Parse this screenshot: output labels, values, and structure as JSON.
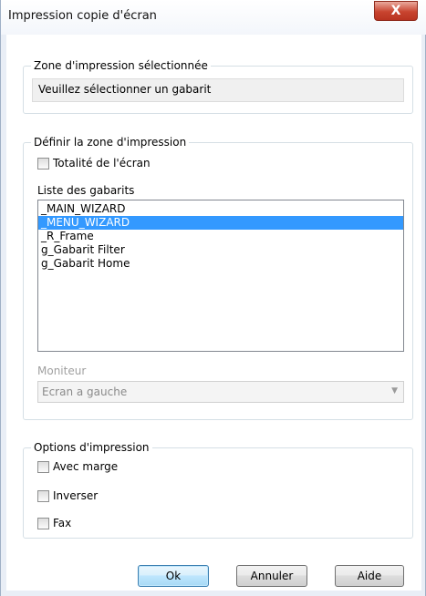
{
  "window": {
    "title": "Impression copie d'écran",
    "close_glyph": "X"
  },
  "zone_selected": {
    "legend": "Zone d'impression sélectionnée",
    "value": "Veuillez sélectionner un gabarit"
  },
  "zone_define": {
    "legend": "Définir la zone d'impression",
    "full_screen_label": "Totalité de l'écran",
    "full_screen_checked": false,
    "templates_label": "Liste des gabarits",
    "templates": [
      {
        "label": "_MAIN_WIZARD",
        "selected": false
      },
      {
        "label": "_MENU_WIZARD",
        "selected": true
      },
      {
        "label": "_R_Frame",
        "selected": false
      },
      {
        "label": "g_Gabarit Filter",
        "selected": false
      },
      {
        "label": "g_Gabarit Home",
        "selected": false
      }
    ],
    "monitor_label": "Moniteur",
    "monitor_value": "Ecran a gauche"
  },
  "options": {
    "legend": "Options d'impression",
    "margin_label": "Avec marge",
    "invert_label": "Inverser",
    "fax_label": "Fax"
  },
  "buttons": {
    "ok": "Ok",
    "cancel": "Annuler",
    "help": "Aide"
  }
}
